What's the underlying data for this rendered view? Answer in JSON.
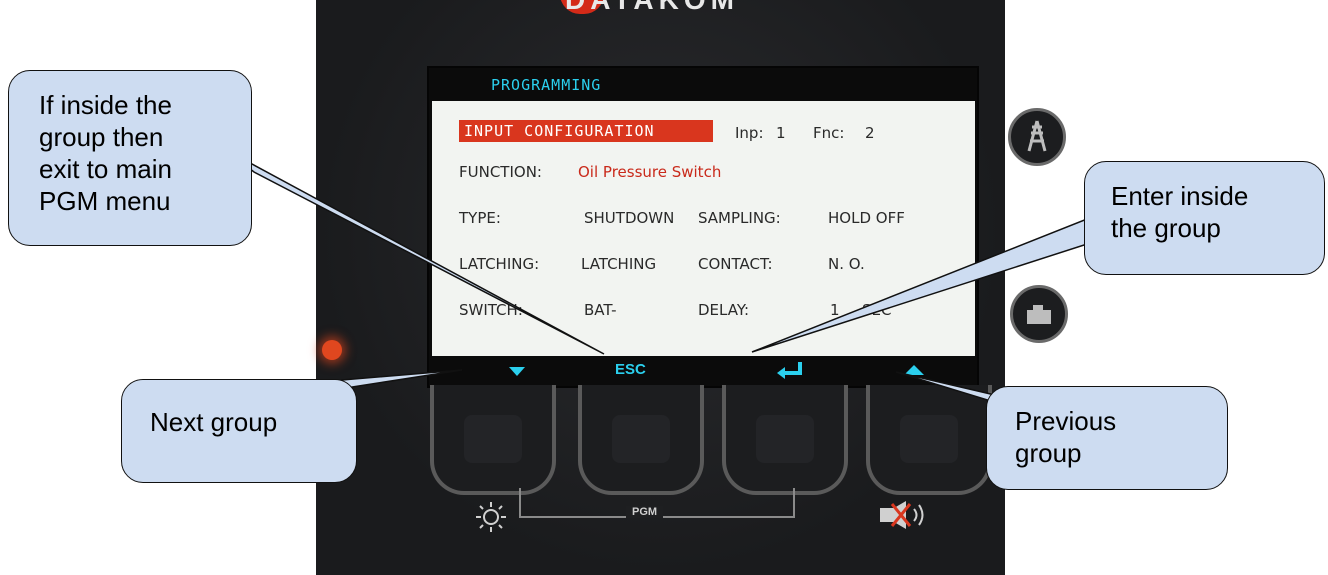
{
  "device": {
    "brand": "DATAKOM",
    "pgm_label": "PGM"
  },
  "lcd": {
    "title": "PROGRAMMING",
    "header": "INPUT CONFIGURATION",
    "inp_label": "Inp:",
    "inp_value": "1",
    "fnc_label": "Fnc:",
    "fnc_value": "2",
    "function_label": "FUNCTION:",
    "function_value": "Oil Pressure Switch",
    "type_label": "TYPE:",
    "type_value": "SHUTDOWN",
    "sampling_label": "SAMPLING:",
    "sampling_value": "HOLD OFF",
    "latching_label": "LATCHING:",
    "latching_value": "LATCHING",
    "contact_label": "CONTACT:",
    "contact_value": "N. O.",
    "switch_label": "SWITCH:",
    "switch_value": "BAT-",
    "delay_label": "DELAY:",
    "delay_value": "1",
    "delay_unit": "SEC",
    "softkeys": {
      "key1_icon": "down-arrow-icon",
      "key2_label": "ESC",
      "key3_icon": "enter-icon",
      "key4_icon": "up-arrow-icon"
    }
  },
  "callouts": {
    "exit": [
      "If inside the",
      "group then",
      "exit to main",
      "PGM menu"
    ],
    "enter": [
      "Enter inside",
      "the group"
    ],
    "next": [
      "Next group"
    ],
    "previous": [
      "Previous",
      "group"
    ]
  },
  "icons": {
    "left_button_icon": "lamp-test-icon",
    "right_button_icon": "horn-mute-icon",
    "side_icon_1": "mains-tower-icon",
    "side_icon_2": "generator-icon"
  },
  "colors": {
    "callout_fill": "#cddcf1",
    "lcd_accent": "#2bd0ee",
    "lcd_header": "#d9361e",
    "led": "#e0471f"
  }
}
